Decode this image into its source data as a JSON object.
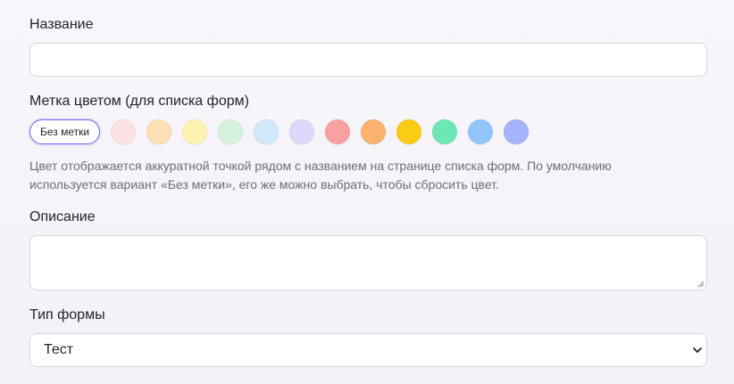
{
  "fields": {
    "name": {
      "label": "Название",
      "value": "",
      "placeholder": ""
    },
    "color_mark": {
      "label": "Метка цветом (для списка форм)",
      "no_mark_label": "Без метки",
      "selected": "none",
      "swatches": [
        {
          "name": "pink-light",
          "color": "#fde2e4"
        },
        {
          "name": "orange-light",
          "color": "#fde0b5"
        },
        {
          "name": "yellow-light",
          "color": "#fef3b0"
        },
        {
          "name": "green-light",
          "color": "#d7f2dc"
        },
        {
          "name": "blue-light",
          "color": "#d1e8fb"
        },
        {
          "name": "lavender-light",
          "color": "#dcd7fb"
        },
        {
          "name": "red",
          "color": "#f9a1a2"
        },
        {
          "name": "orange",
          "color": "#fbb26f"
        },
        {
          "name": "yellow",
          "color": "#facc15"
        },
        {
          "name": "green",
          "color": "#6ee7b7"
        },
        {
          "name": "blue",
          "color": "#93c5fd"
        },
        {
          "name": "indigo",
          "color": "#a5b4fc"
        }
      ],
      "hint": "Цвет отображается аккуратной точкой рядом с названием на странице списка форм. По умолчанию используется вариант «Без метки», его же можно выбрать, чтобы сбросить цвет."
    },
    "description": {
      "label": "Описание",
      "value": ""
    },
    "form_type": {
      "label": "Тип формы",
      "value": "Тест",
      "icon": "chevron-down-icon"
    }
  },
  "colors": {
    "accent": "#6366f1",
    "border": "#d6d6dc",
    "hint_text": "#6b6f76"
  }
}
